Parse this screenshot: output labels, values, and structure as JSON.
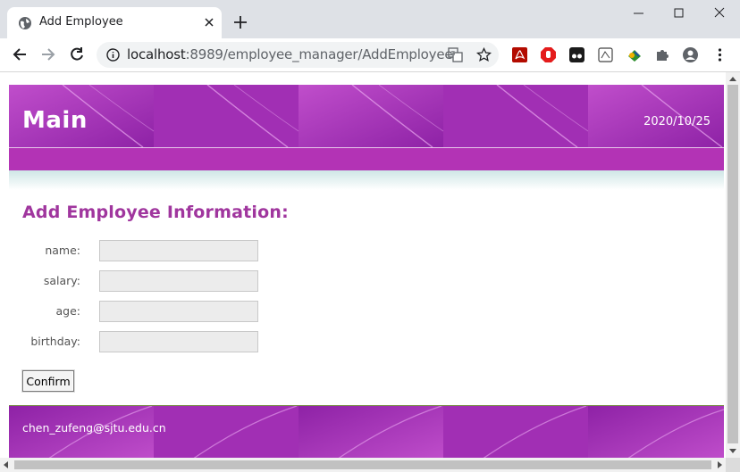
{
  "browser": {
    "tab_title": "Add Employee",
    "url_host": "localhost",
    "url_rest": ":8989/employee_manager/AddEmployee",
    "icons": [
      "globe-icon",
      "close-icon",
      "new-tab-icon",
      "minimize-icon",
      "maximize-icon",
      "window-close-icon",
      "back-icon",
      "forward-icon",
      "reload-icon",
      "info-icon",
      "translate-icon",
      "star-icon",
      "pdf-extension-icon",
      "adblock-extension-icon",
      "extension-icon",
      "extension-icon",
      "extension-icon",
      "puzzle-icon",
      "profile-icon",
      "menu-icon"
    ]
  },
  "site": {
    "title": "Main",
    "date": "2020/10/25",
    "accent_color": "#b333b5",
    "heading_color": "#a0369e"
  },
  "form": {
    "heading": "Add Employee Information:",
    "fields": [
      {
        "label": "name:",
        "value": ""
      },
      {
        "label": "salary:",
        "value": ""
      },
      {
        "label": "age:",
        "value": ""
      },
      {
        "label": "birthday:",
        "value": ""
      }
    ],
    "confirm_label": "Confirm"
  },
  "footer": {
    "email": "chen_zufeng@sjtu.edu.cn"
  }
}
